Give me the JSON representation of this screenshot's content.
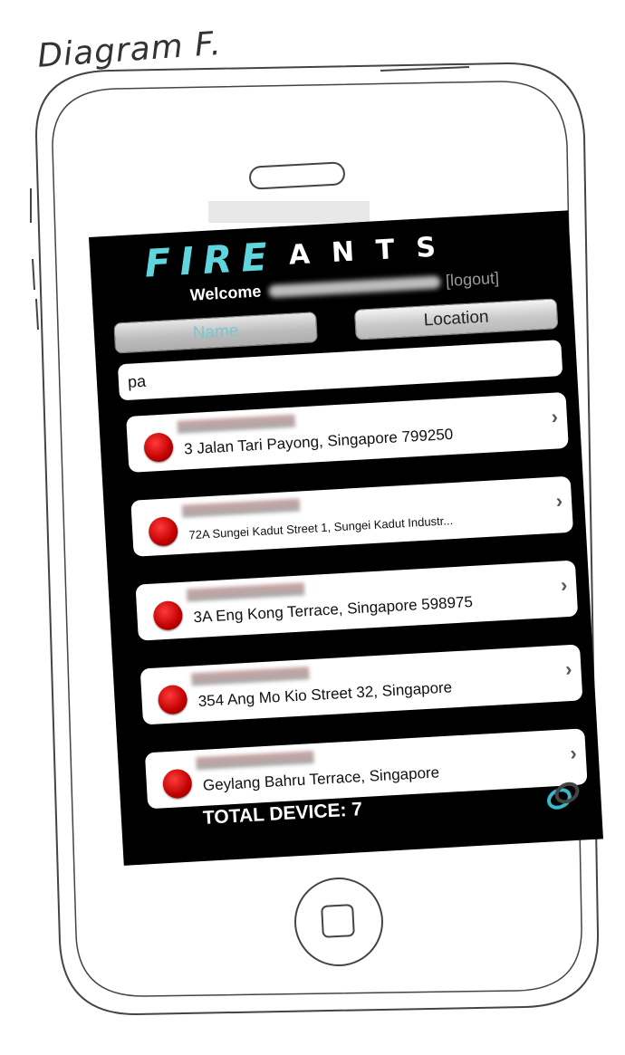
{
  "caption": "Diagram F.",
  "header": {
    "logo_fire": "FIRE",
    "logo_ants": "ANTS",
    "welcome": "Welcome",
    "logout": "[logout]"
  },
  "segments": {
    "name": "Name",
    "location": "Location",
    "selected": "Name"
  },
  "search": {
    "value": "pa"
  },
  "devices": [
    {
      "address": "3 Jalan Tari Payong, Singapore 799250",
      "status_color": "#d10000"
    },
    {
      "address": "72A Sungei Kadut Street 1, Sungei Kadut Industr...",
      "status_color": "#d10000"
    },
    {
      "address": "3A Eng Kong Terrace, Singapore 598975",
      "status_color": "#d10000"
    },
    {
      "address": "354 Ang Mo Kio Street 32, Singapore",
      "status_color": "#d10000"
    },
    {
      "address": "Geylang Bahru Terrace, Singapore",
      "status_color": "#d10000"
    }
  ],
  "footer": {
    "total": "TOTAL DEVICE: 7",
    "brand_icon": "rings-logo-icon"
  },
  "colors": {
    "accent": "#5fd6de",
    "screen_bg": "#000000",
    "status_red": "#d10000"
  }
}
